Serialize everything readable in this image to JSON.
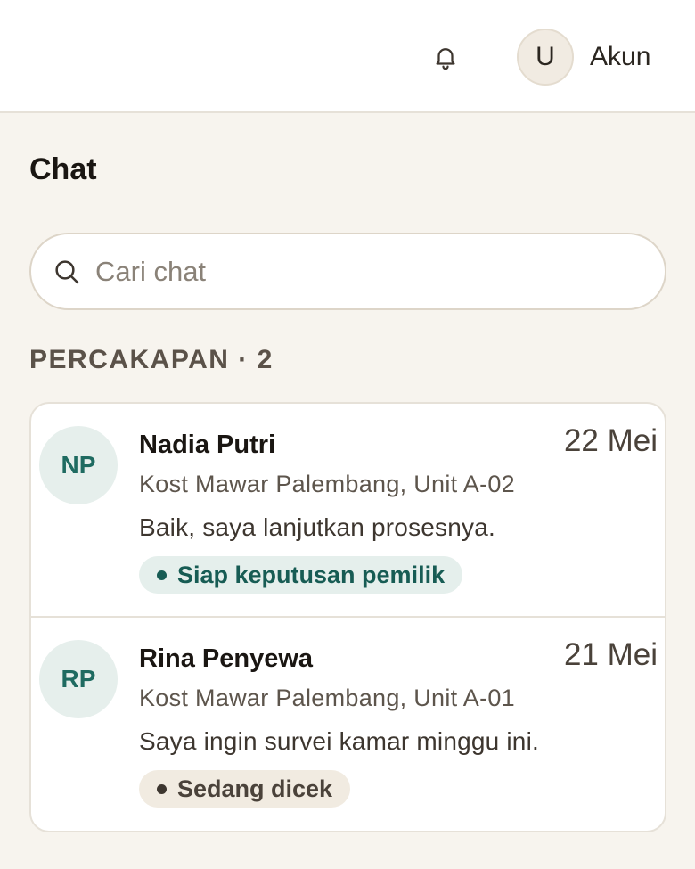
{
  "header": {
    "notification_icon": "bell-icon",
    "account": {
      "avatar_initial": "U",
      "label": "Akun"
    }
  },
  "page": {
    "title": "Chat"
  },
  "search": {
    "placeholder": "Cari chat",
    "value": "",
    "icon": "search-icon"
  },
  "section": {
    "label": "PERCAKAPAN · 2"
  },
  "conversations": [
    {
      "initials": "NP",
      "name": "Nadia Putri",
      "date": "22 Mei",
      "property": "Kost Mawar Palembang, Unit A-02",
      "last_message": "Baik, saya lanjutkan prosesnya.",
      "status": "Siap keputusan pemilik"
    },
    {
      "initials": "RP",
      "name": "Rina Penyewa",
      "date": "21 Mei",
      "property": "Kost Mawar Palembang, Unit A-01",
      "last_message": "Saya ingin survei kamar minggu ini.",
      "status": "Sedang dicek"
    }
  ],
  "colors": {
    "background": "#f7f4ee",
    "accent_teal": "#175c54",
    "status_ready_bg": "#e5efec",
    "status_checking_bg": "#f1ebe1"
  }
}
